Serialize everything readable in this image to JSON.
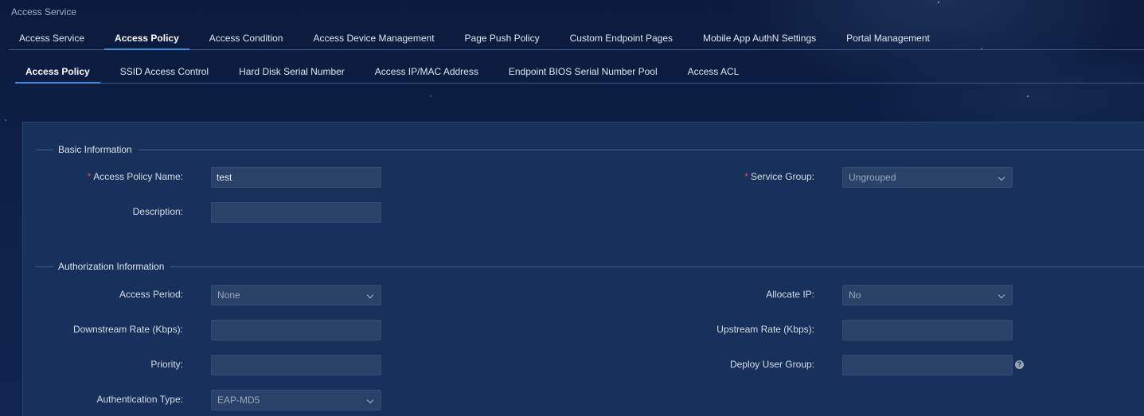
{
  "app": {
    "title": "Access Service"
  },
  "main_tabs": [
    {
      "label": "Access Service",
      "active": false
    },
    {
      "label": "Access Policy",
      "active": true
    },
    {
      "label": "Access Condition",
      "active": false
    },
    {
      "label": "Access Device Management",
      "active": false
    },
    {
      "label": "Page Push Policy",
      "active": false
    },
    {
      "label": "Custom Endpoint Pages",
      "active": false
    },
    {
      "label": "Mobile App AuthN Settings",
      "active": false
    },
    {
      "label": "Portal Management",
      "active": false
    }
  ],
  "sub_tabs": [
    {
      "label": "Access Policy",
      "active": true
    },
    {
      "label": "SSID Access Control",
      "active": false
    },
    {
      "label": "Hard Disk Serial Number",
      "active": false
    },
    {
      "label": "Access IP/MAC Address",
      "active": false
    },
    {
      "label": "Endpoint BIOS Serial Number Pool",
      "active": false
    },
    {
      "label": "Access ACL",
      "active": false
    }
  ],
  "basic": {
    "section_label": "Basic Information",
    "policy_name": {
      "label": "Access Policy Name:",
      "value": "test",
      "required": "*"
    },
    "service_group": {
      "label": "Service Group:",
      "value": "Ungrouped",
      "required": "*"
    },
    "description": {
      "label": "Description:",
      "value": ""
    }
  },
  "authz": {
    "section_label": "Authorization Information",
    "access_period": {
      "label": "Access Period:",
      "value": "None"
    },
    "allocate_ip": {
      "label": "Allocate IP:",
      "value": "No"
    },
    "downstream_rate": {
      "label": "Downstream Rate (Kbps):",
      "value": ""
    },
    "upstream_rate": {
      "label": "Upstream Rate (Kbps):",
      "value": ""
    },
    "priority": {
      "label": "Priority:",
      "value": ""
    },
    "deploy_user_group": {
      "label": "Deploy User Group:",
      "value": "",
      "help": "?"
    },
    "auth_type": {
      "label": "Authentication Type:",
      "value": "EAP-MD5"
    }
  },
  "icons": {
    "dropdown": "chevron-down-icon",
    "help": "question-circle-icon"
  },
  "colors": {
    "background": "#0d2046",
    "panel": "#17315a",
    "input": "#2a4268",
    "accent": "#3a8ee6",
    "required": "#e04848"
  }
}
